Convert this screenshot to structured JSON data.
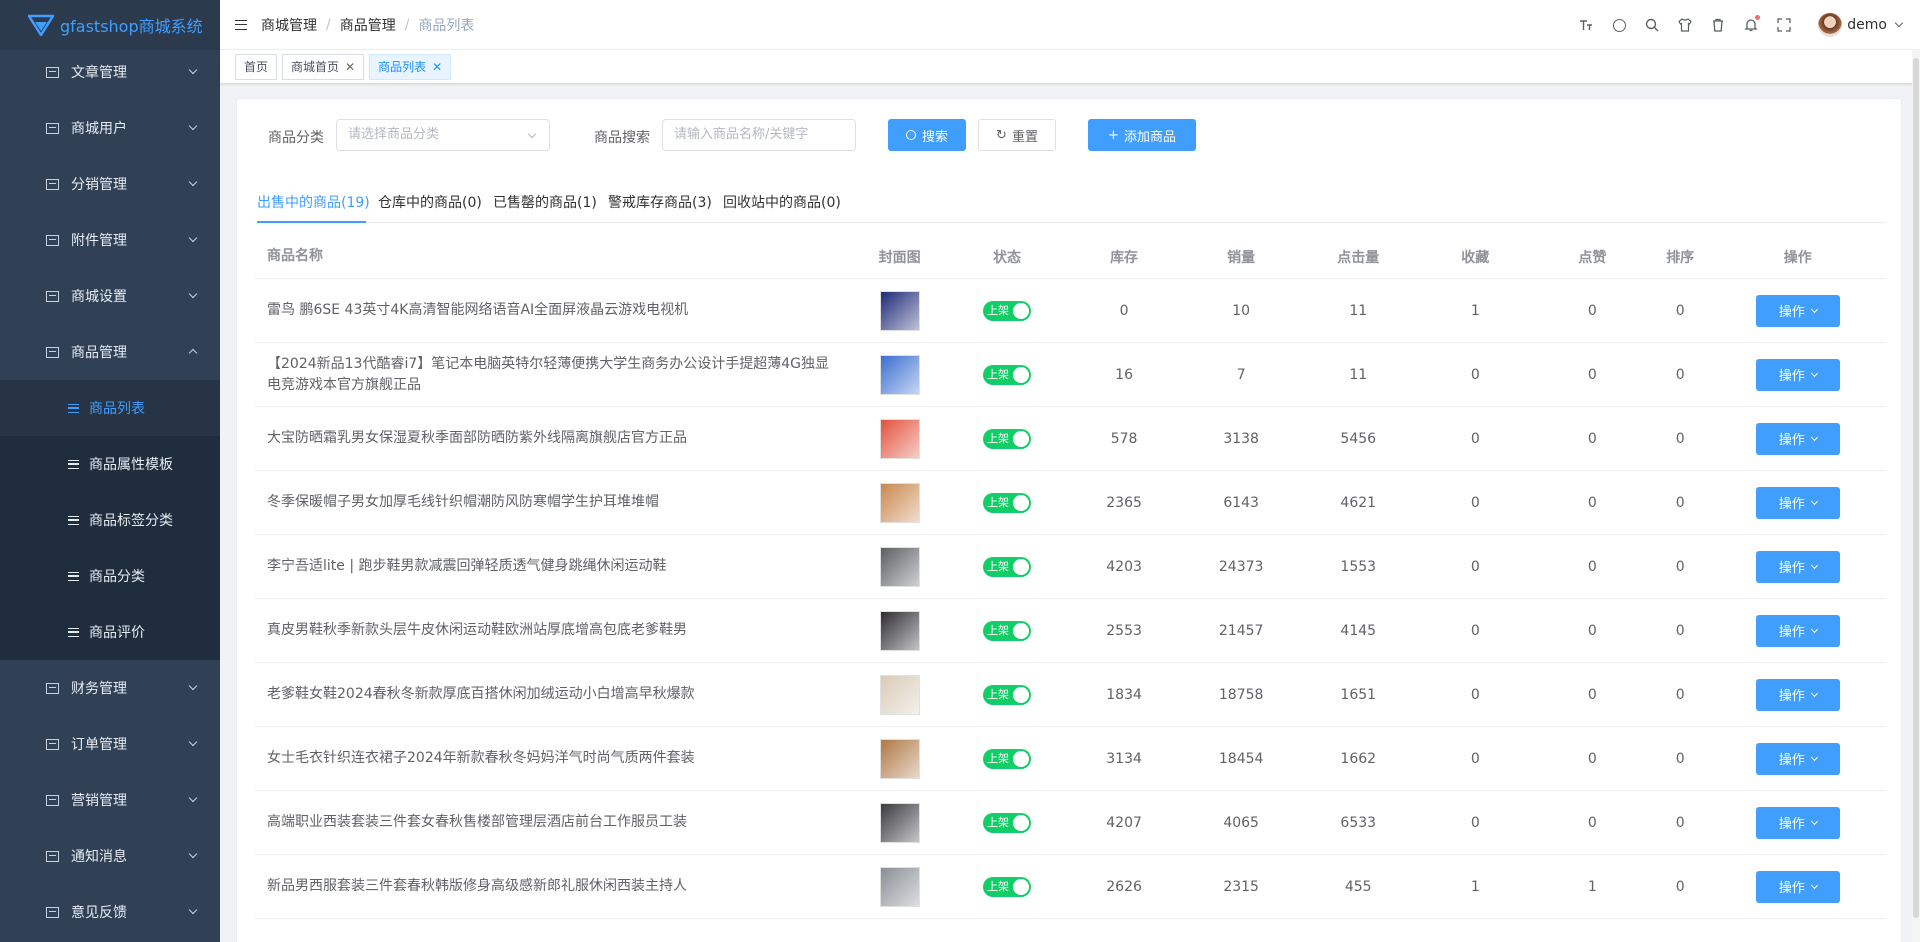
{
  "app": {
    "title": "gfastshop商城系统"
  },
  "sidebar": {
    "top_menu": [
      {
        "label": "文章管理"
      },
      {
        "label": "商城用户"
      },
      {
        "label": "分销管理"
      },
      {
        "label": "附件管理"
      },
      {
        "label": "商城设置"
      },
      {
        "label": "商品管理",
        "expanded": true
      }
    ],
    "sub_menu": [
      {
        "label": "商品列表",
        "active": true
      },
      {
        "label": "商品属性模板"
      },
      {
        "label": "商品标签分类"
      },
      {
        "label": "商品分类"
      },
      {
        "label": "商品评价"
      }
    ],
    "bottom_menu": [
      {
        "label": "财务管理"
      },
      {
        "label": "订单管理"
      },
      {
        "label": "营销管理"
      },
      {
        "label": "通知消息"
      },
      {
        "label": "意见反馈"
      }
    ]
  },
  "header": {
    "breadcrumb": [
      "商城管理",
      "商品管理",
      "商品列表"
    ],
    "username": "demo"
  },
  "tags": [
    {
      "label": "首页",
      "closable": false
    },
    {
      "label": "商城首页",
      "closable": true
    },
    {
      "label": "商品列表",
      "closable": true,
      "active": true
    }
  ],
  "filters": {
    "category_label": "商品分类",
    "category_placeholder": "请选择商品分类",
    "search_label": "商品搜索",
    "search_placeholder": "请输入商品名称/关键字",
    "search_button": "搜索",
    "reset_button": "重置",
    "add_button": "添加商品"
  },
  "tabs": [
    {
      "label": "出售中的商品(19)",
      "active": true
    },
    {
      "label": "仓库中的商品(0)"
    },
    {
      "label": "已售罄的商品(1)"
    },
    {
      "label": "警戒库存商品(3)"
    },
    {
      "label": "回收站中的商品(0)"
    }
  ],
  "table": {
    "headers": {
      "name": "商品名称",
      "cover": "封面图",
      "status": "状态",
      "stock": "库存",
      "sales": "销量",
      "clicks": "点击量",
      "favorites": "收藏",
      "likes": "点赞",
      "sort": "排序",
      "ops": "操作"
    },
    "status_label": "上架",
    "op_label": "操作",
    "rows": [
      {
        "name": "雷鸟 鹏6SE 43英寸4K高清智能网络语音AI全面屏液晶云游戏电视机",
        "stock": "0",
        "sales": "10",
        "clicks": "11",
        "favorites": "1",
        "likes": "0",
        "sort": "0",
        "thumb_color": "#1e2a78"
      },
      {
        "name": "【2024新品13代酷睿i7】笔记本电脑英特尔轻薄便携大学生商务办公设计手提超薄4G独显电竞游戏本官方旗舰正品",
        "stock": "16",
        "sales": "7",
        "clicks": "11",
        "favorites": "0",
        "likes": "0",
        "sort": "0",
        "thumb_color": "#3b6fd1"
      },
      {
        "name": "大宝防晒霜乳男女保湿夏秋季面部防晒防紫外线隔离旗舰店官方正品",
        "stock": "578",
        "sales": "3138",
        "clicks": "5456",
        "favorites": "0",
        "likes": "0",
        "sort": "0",
        "thumb_color": "#e2533d"
      },
      {
        "name": "冬季保暖帽子男女加厚毛线针织帽潮防风防寒帽学生护耳堆堆帽",
        "stock": "2365",
        "sales": "6143",
        "clicks": "4621",
        "favorites": "0",
        "likes": "0",
        "sort": "0",
        "thumb_color": "#c9884e"
      },
      {
        "name": "李宁吾适lite | 跑步鞋男款减震回弹轻质透气健身跳绳休闲运动鞋",
        "stock": "4203",
        "sales": "24373",
        "clicks": "1553",
        "favorites": "0",
        "likes": "0",
        "sort": "0",
        "thumb_color": "#5b5e63"
      },
      {
        "name": "真皮男鞋秋季新款头层牛皮休闲运动鞋欧洲站厚底增高包底老爹鞋男",
        "stock": "2553",
        "sales": "21457",
        "clicks": "4145",
        "favorites": "0",
        "likes": "0",
        "sort": "0",
        "thumb_color": "#2e2c33"
      },
      {
        "name": "老爹鞋女鞋2024春秋冬新款厚底百搭休闲加绒运动小白增高早秋爆款",
        "stock": "1834",
        "sales": "18758",
        "clicks": "1651",
        "favorites": "0",
        "likes": "0",
        "sort": "0",
        "thumb_color": "#d9cbb9"
      },
      {
        "name": "女士毛衣针织连衣裙子2024年新款春秋冬妈妈洋气时尚气质两件套装",
        "stock": "3134",
        "sales": "18454",
        "clicks": "1662",
        "favorites": "0",
        "likes": "0",
        "sort": "0",
        "thumb_color": "#b07845"
      },
      {
        "name": "高端职业西装套装三件套女春秋售楼部管理层酒店前台工作服员工装",
        "stock": "4207",
        "sales": "4065",
        "clicks": "6533",
        "favorites": "0",
        "likes": "0",
        "sort": "0",
        "thumb_color": "#3a3a40"
      },
      {
        "name": "新品男西服套装三件套春秋韩版修身高级感新郎礼服休闲西装主持人",
        "stock": "2626",
        "sales": "2315",
        "clicks": "455",
        "favorites": "1",
        "likes": "1",
        "sort": "0",
        "thumb_color": "#8a8e96"
      }
    ]
  },
  "colors": {
    "sidebar": "#304156",
    "primary": "#409eff",
    "switch_on": "#13ce66"
  }
}
